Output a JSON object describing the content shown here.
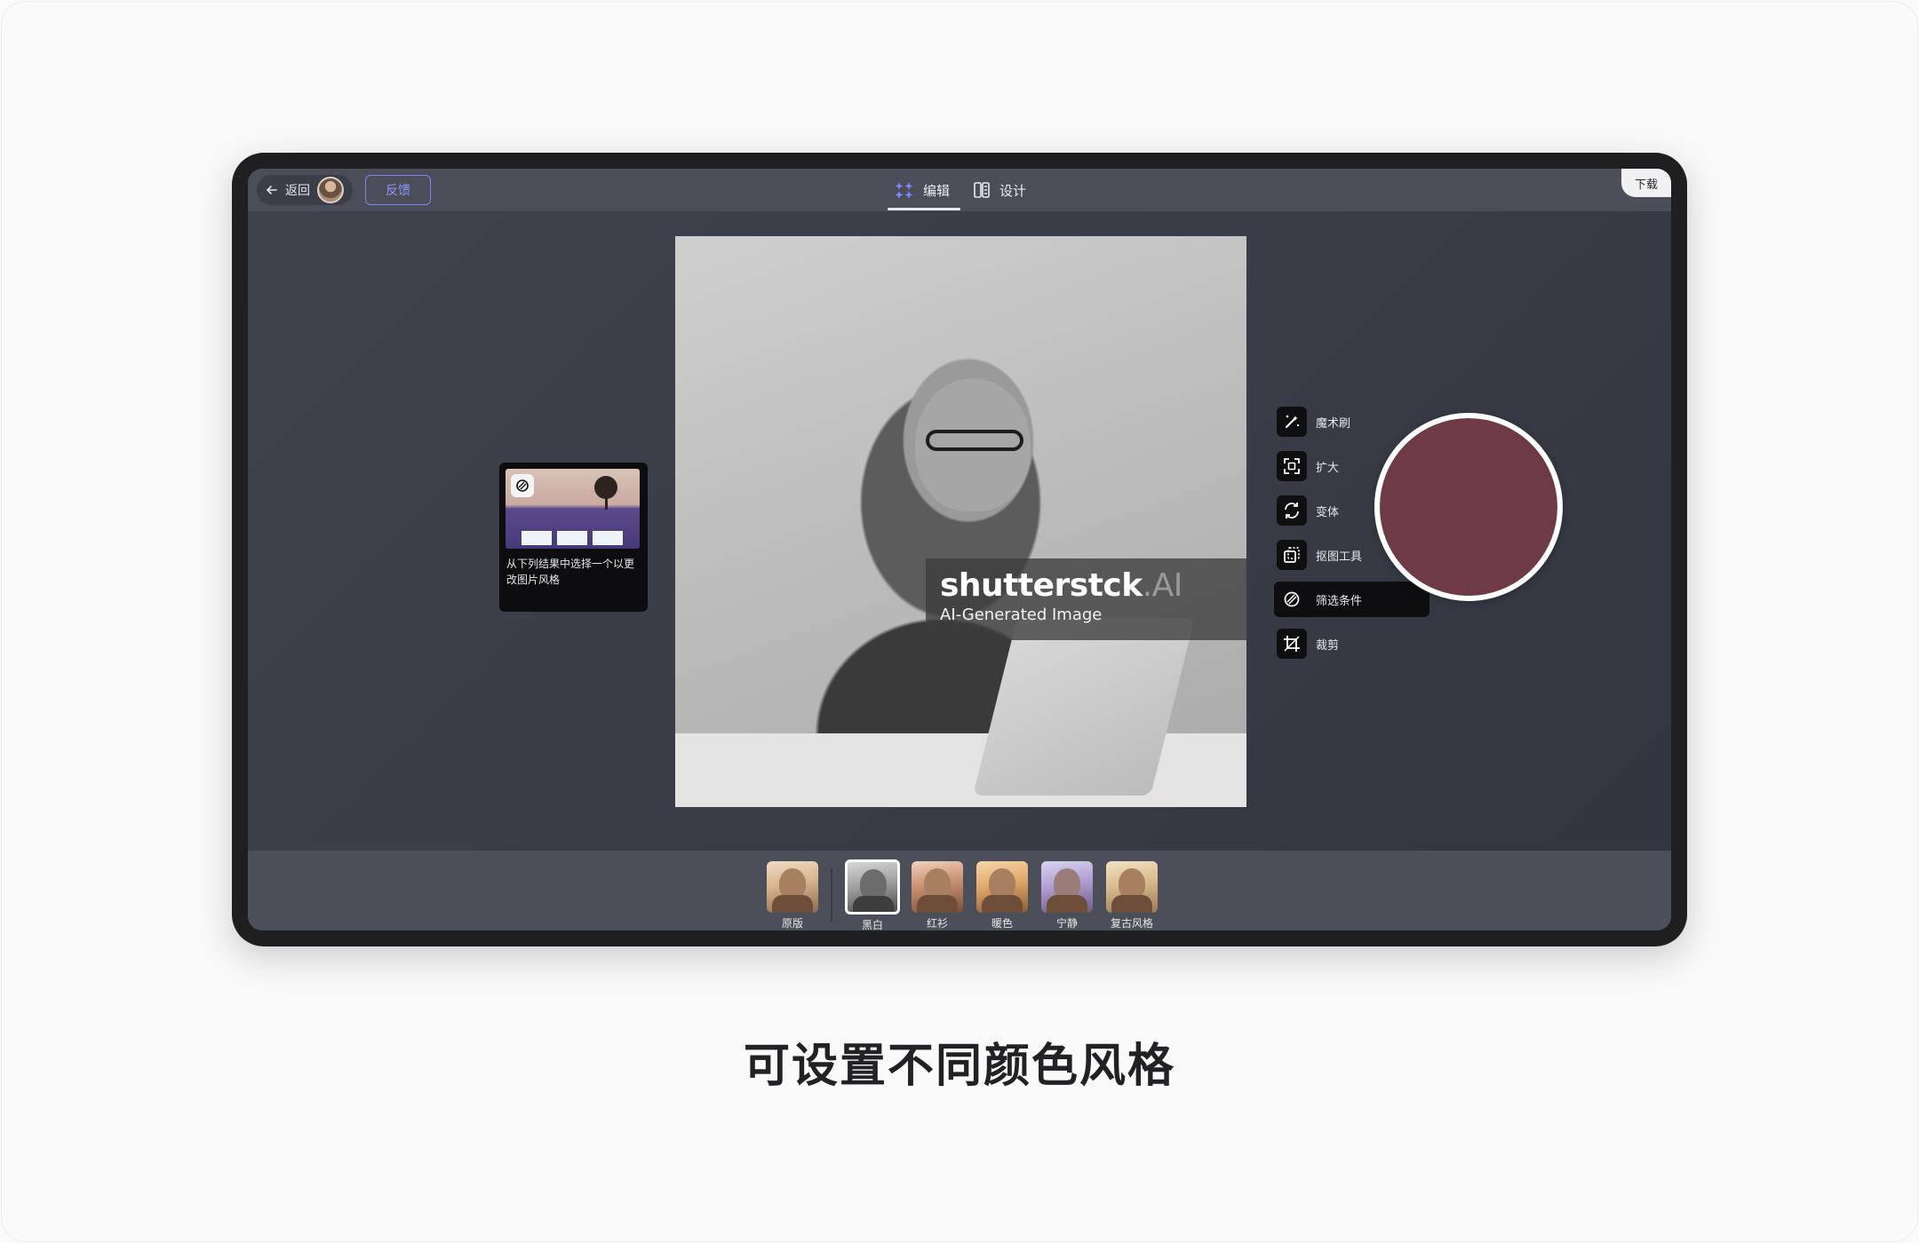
{
  "topbar": {
    "back_label": "返回",
    "feedback_label": "反馈",
    "tabs": [
      {
        "label": "编辑",
        "icon": "sparkle-grid-icon"
      },
      {
        "label": "设计",
        "icon": "panels-icon"
      }
    ],
    "download_label": "下载"
  },
  "canvas": {
    "watermark_brand": "shutterstck",
    "watermark_brand_ai": ".AI",
    "watermark_sub": "AI-Generated Image"
  },
  "popup": {
    "text": "从下列结果中选择一个以更改图片风格"
  },
  "tools": [
    {
      "label": "魔术刷",
      "icon": "magic-brush-icon"
    },
    {
      "label": "扩大",
      "icon": "expand-icon"
    },
    {
      "label": "变体",
      "icon": "variation-icon"
    },
    {
      "label": "抠图工具",
      "icon": "cutout-icon"
    },
    {
      "label": "筛选条件",
      "icon": "filter-icon",
      "active": true
    },
    {
      "label": "裁剪",
      "icon": "crop-icon"
    }
  ],
  "swatch_color": "#6e3a45",
  "filters": [
    {
      "label": "原版"
    },
    {
      "label": "黑白",
      "selected": true
    },
    {
      "label": "红衫"
    },
    {
      "label": "暖色"
    },
    {
      "label": "宁静"
    },
    {
      "label": "复古风格"
    }
  ],
  "caption": "可设置不同颜色风格"
}
